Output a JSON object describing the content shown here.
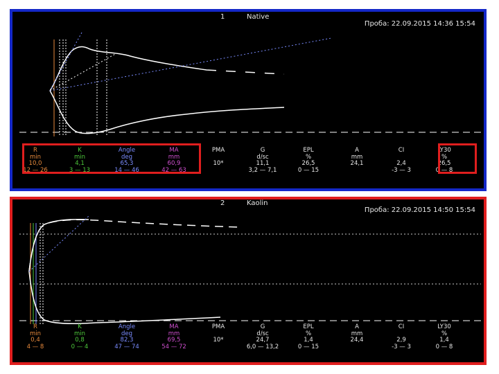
{
  "colors": {
    "panel1_border": "#1428c8",
    "panel2_border": "#e01e1e",
    "highlight_border": "#e01e1e",
    "trace": "#ffffff",
    "R": "#e88a3c",
    "K": "#4ecb3c",
    "Angle": "#7a8cff",
    "MA": "#d050d0",
    "neutral": "#e8e8e8"
  },
  "panels": [
    {
      "number": "1",
      "title": "Native",
      "sample": "Проба: 22.09.2015 14:36 15:54",
      "params": [
        {
          "name": "R",
          "unit": "min",
          "value": "10,0",
          "range": "12 — 26",
          "color": "#e88a3c"
        },
        {
          "name": "K",
          "unit": "min",
          "value": "4,1",
          "range": "3 — 13",
          "color": "#4ecb3c"
        },
        {
          "name": "Angle",
          "unit": "deg",
          "value": "65,3",
          "range": "14 — 46",
          "color": "#7a8cff"
        },
        {
          "name": "MA",
          "unit": "mm",
          "value": "60,9",
          "range": "42 — 63",
          "color": "#d050d0"
        },
        {
          "name": "PMA",
          "unit": "",
          "value": "10*",
          "range": "",
          "color": "#e8e8e8"
        },
        {
          "name": "G",
          "unit": "d/sc",
          "value": "11,1",
          "range": "3,2 — 7,1",
          "color": "#e8e8e8"
        },
        {
          "name": "EPL",
          "unit": "%",
          "value": "26,5",
          "range": "0 — 15",
          "color": "#e8e8e8"
        },
        {
          "name": "A",
          "unit": "mm",
          "value": "24,1",
          "range": "",
          "color": "#e8e8e8"
        },
        {
          "name": "CI",
          "unit": "",
          "value": "2,4",
          "range": "-3 — 3",
          "color": "#e8e8e8"
        },
        {
          "name": "LY30",
          "unit": "%",
          "value": "26,5",
          "range": "0 — 8",
          "color": "#e8e8e8"
        }
      ]
    },
    {
      "number": "2",
      "title": "Kaolin",
      "sample": "Проба: 22.09.2015 14:50 15:54",
      "params": [
        {
          "name": "R",
          "unit": "min",
          "value": "0,4",
          "range": "4 — 8",
          "color": "#e88a3c"
        },
        {
          "name": "K",
          "unit": "min",
          "value": "0,8",
          "range": "0 — 4",
          "color": "#4ecb3c"
        },
        {
          "name": "Angle",
          "unit": "deg",
          "value": "82,3",
          "range": "47 — 74",
          "color": "#7a8cff"
        },
        {
          "name": "MA",
          "unit": "mm",
          "value": "69,5",
          "range": "54 — 72",
          "color": "#d050d0"
        },
        {
          "name": "PMA",
          "unit": "",
          "value": "10*",
          "range": "",
          "color": "#e8e8e8"
        },
        {
          "name": "G",
          "unit": "d/sc",
          "value": "24,7",
          "range": "6,0 — 13,2",
          "color": "#e8e8e8"
        },
        {
          "name": "EPL",
          "unit": "%",
          "value": "1,4",
          "range": "0 — 15",
          "color": "#e8e8e8"
        },
        {
          "name": "A",
          "unit": "mm",
          "value": "24,4",
          "range": "",
          "color": "#e8e8e8"
        },
        {
          "name": "CI",
          "unit": "",
          "value": "2,9",
          "range": "-3 — 3",
          "color": "#e8e8e8"
        },
        {
          "name": "LY30",
          "unit": "%",
          "value": "1,4",
          "range": "0 — 8",
          "color": "#e8e8e8"
        }
      ]
    }
  ],
  "chart_data": [
    {
      "type": "line",
      "title": "Native",
      "series": [
        {
          "x": [
            0,
            5,
            10,
            15,
            20,
            25,
            30,
            45,
            60
          ],
          "upper": [
            0,
            8,
            22,
            27,
            29,
            30,
            27,
            18,
            14
          ],
          "lower": [
            0,
            -8,
            -22,
            -27,
            -29,
            -30,
            -27,
            -18,
            -14
          ]
        }
      ],
      "markers": {
        "R": 10.0,
        "K": 4.1,
        "MA": 60.9
      }
    },
    {
      "type": "line",
      "title": "Kaolin",
      "series": [
        {
          "x": [
            0,
            1,
            2,
            5,
            10,
            20,
            30,
            45,
            60
          ],
          "upper": [
            0,
            20,
            30,
            34,
            35,
            35,
            34,
            33,
            32
          ],
          "lower": [
            0,
            -20,
            -30,
            -34,
            -35,
            -35,
            -34,
            -33,
            -32
          ]
        }
      ],
      "markers": {
        "R": 0.4,
        "K": 0.8,
        "MA": 69.5
      }
    }
  ]
}
